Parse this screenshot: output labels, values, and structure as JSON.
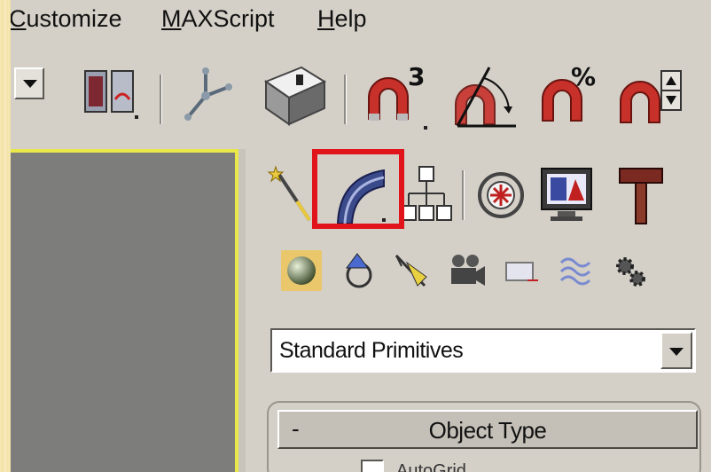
{
  "menu": {
    "items": [
      {
        "label": "Customize"
      },
      {
        "label": "MAXScript"
      },
      {
        "label": "Help"
      }
    ]
  },
  "toolbar": {
    "buttons": [
      {
        "icon": "dropdown-arrow-icon"
      },
      {
        "icon": "layer-panels-icon"
      },
      {
        "icon": "transform-gizmo-icon"
      },
      {
        "icon": "render-teapot-icon"
      },
      {
        "icon": "snap-3d-magnet-icon",
        "badge": "3"
      },
      {
        "icon": "angle-snap-icon"
      },
      {
        "icon": "percent-snap-icon",
        "badge": "%"
      },
      {
        "icon": "spinner-snap-icon"
      }
    ]
  },
  "command_panel": {
    "tabs": [
      {
        "name": "create-tab",
        "icon": "create-wand-icon"
      },
      {
        "name": "modify-tab",
        "icon": "modify-bend-icon",
        "highlighted": true
      },
      {
        "name": "hierarchy-tab",
        "icon": "hierarchy-icon"
      },
      {
        "name": "motion-tab",
        "icon": "motion-wheel-icon"
      },
      {
        "name": "display-tab",
        "icon": "display-monitor-icon"
      },
      {
        "name": "utilities-tab",
        "icon": "utilities-hammer-icon"
      }
    ],
    "subcategories": [
      {
        "icon": "geometry-sphere-icon",
        "active": true
      },
      {
        "icon": "shapes-icon"
      },
      {
        "icon": "lights-icon"
      },
      {
        "icon": "cameras-icon"
      },
      {
        "icon": "helpers-icon"
      },
      {
        "icon": "spacewarps-icon"
      },
      {
        "icon": "systems-gear-icon"
      }
    ],
    "category_select": {
      "value": "Standard Primitives"
    },
    "rollout": {
      "collapse_symbol": "-",
      "title": "Object Type",
      "autogrid_label": "AutoGrid"
    }
  },
  "colors": {
    "panel_bg": "#d4d0c8",
    "viewport_bg": "#7d7d7b",
    "viewport_border": "#e8e84a",
    "highlight": "#e0141a",
    "background": "#f6e8b4"
  }
}
